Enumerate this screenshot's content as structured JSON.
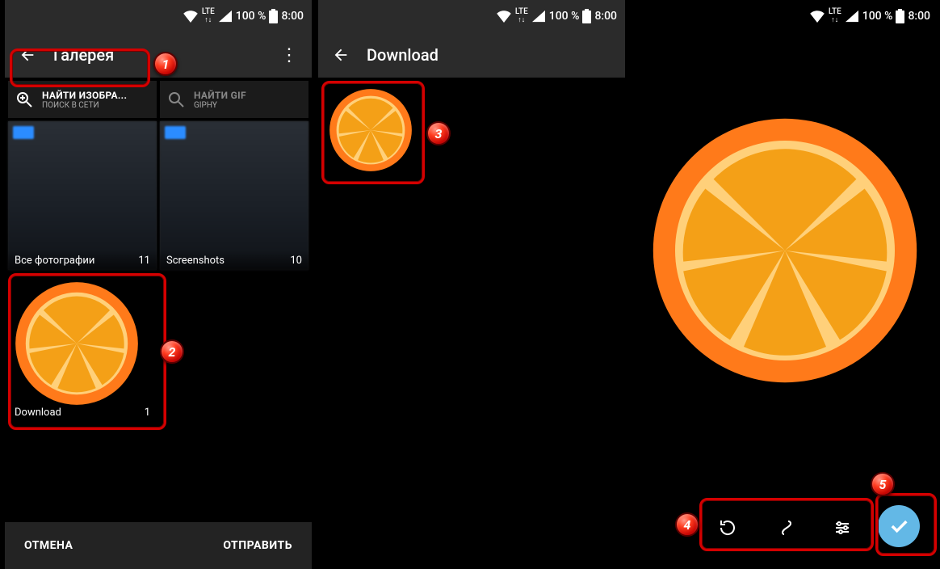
{
  "status": {
    "lte": "LTE",
    "battery": "100 %",
    "time": "8:00"
  },
  "screen1": {
    "title": "Галерея",
    "searchImages": {
      "title": "НАЙТИ ИЗОБРА...",
      "subtitle": "ПОИСК В СЕТИ"
    },
    "searchGif": {
      "title": "НАЙТИ GIF",
      "subtitle": "GIPHY"
    },
    "albums": [
      {
        "name": "Все фотографии",
        "count": "11"
      },
      {
        "name": "Screenshots",
        "count": "10"
      },
      {
        "name": "Download",
        "count": "1"
      }
    ],
    "cancel": "ОТМЕНА",
    "send": "ОТПРАВИТЬ"
  },
  "screen2": {
    "title": "Download"
  },
  "badges": {
    "b1": "1",
    "b2": "2",
    "b3": "3",
    "b4": "4",
    "b5": "5"
  }
}
